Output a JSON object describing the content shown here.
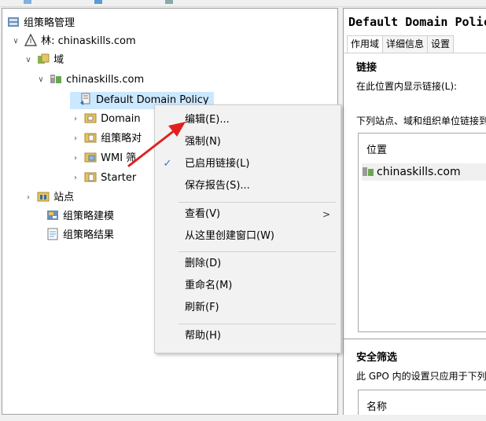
{
  "tree": {
    "root_label": "组策略管理",
    "forest_label": "林: chinaskills.com",
    "domains_label": "域",
    "domain_label": "chinaskills.com",
    "default_policy_label": "Default Domain Policy",
    "domain_controllers_label": "Domain",
    "gpo_label": "组策略对",
    "wmi_label": "WMI 筛",
    "starter_label": "Starter",
    "sites_label": "站点",
    "modeling_label": "组策略建模",
    "results_label": "组策略结果"
  },
  "right_pane": {
    "title": "Default Domain Policy",
    "tabs": [
      "作用域",
      "详细信息",
      "设置"
    ],
    "links_header": "链接",
    "show_links_text": "在此位置内显示链接(L):",
    "linked_desc": "下列站点、域和组织单位链接到此 GPO:",
    "location_col": "位置",
    "location_item": "chinaskills.com",
    "security_header": "安全筛选",
    "security_desc": "此 GPO 内的设置只应用于下列组、用户和计算机:",
    "name_col": "名称"
  },
  "context_menu": {
    "items": [
      {
        "label": "编辑(E)...",
        "checked": false,
        "submenu": false
      },
      {
        "label": "强制(N)",
        "checked": false,
        "submenu": false
      },
      {
        "label": "已启用链接(L)",
        "checked": true,
        "submenu": false
      },
      {
        "label": "保存报告(S)...",
        "checked": false,
        "submenu": false
      },
      {
        "label": "查看(V)",
        "checked": false,
        "submenu": true
      },
      {
        "label": "从这里创建窗口(W)",
        "checked": false,
        "submenu": false
      },
      {
        "label": "删除(D)",
        "checked": false,
        "submenu": false
      },
      {
        "label": "重命名(M)",
        "checked": false,
        "submenu": false
      },
      {
        "label": "刷新(F)",
        "checked": false,
        "submenu": false
      },
      {
        "label": "帮助(H)",
        "checked": false,
        "submenu": false
      }
    ],
    "check_glyph": "✓",
    "submenu_glyph": ">"
  },
  "colors": {
    "selection": "#cce8ff",
    "check": "#1e78d4",
    "annotation_arrow": "#e02020"
  }
}
